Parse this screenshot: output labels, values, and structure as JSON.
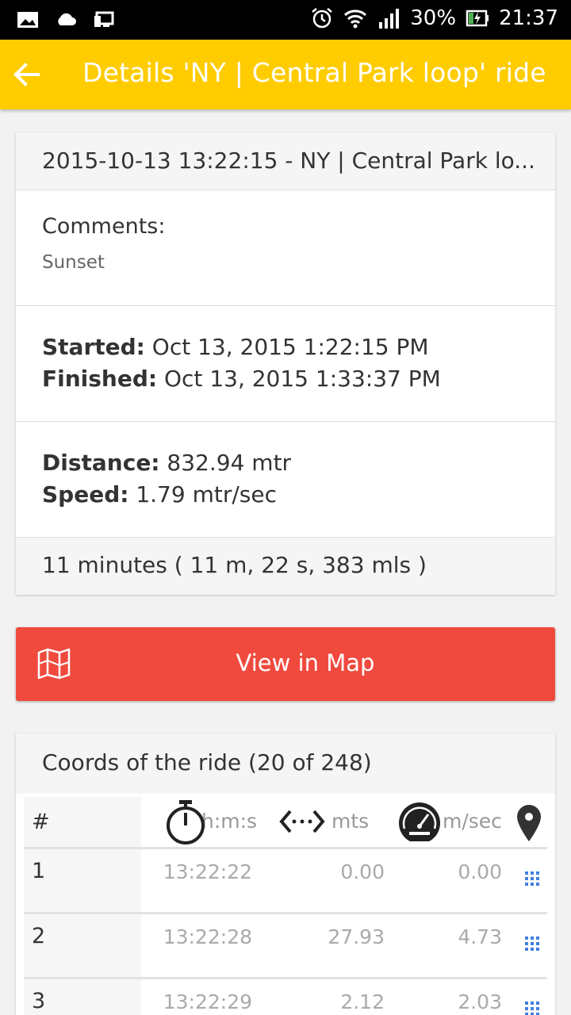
{
  "status_bar": {
    "battery": "30%",
    "time": "21:37",
    "icons": [
      "image-icon",
      "cloud-icon",
      "device-icon",
      "alarm-icon",
      "wifi-icon",
      "signal-icon",
      "battery-charging-icon"
    ]
  },
  "app_bar": {
    "title": "Details 'NY | Central Park loop' ride",
    "back_icon": "arrow-left-icon"
  },
  "ride_card": {
    "header": "2015-10-13 13:22:15 - NY | Central Park lo...",
    "comments_label": "Comments:",
    "comments_value": "Sunset",
    "started_label": "Started:",
    "started_value": "Oct 13, 2015 1:22:15 PM",
    "finished_label": "Finished:",
    "finished_value": "Oct 13, 2015 1:33:37 PM",
    "distance_label": "Distance:",
    "distance_value": "832.94 mtr",
    "speed_label": "Speed:",
    "speed_value": "1.79 mtr/sec",
    "duration": "11 minutes ( 11 m, 22 s, 383 mls )"
  },
  "map_button": {
    "label": "View in Map",
    "icon": "map-icon",
    "color": "#f04a3e"
  },
  "coords_card": {
    "header": "Coords of the ride (20 of 248)",
    "columns": {
      "num": "#",
      "time": "h:m:s",
      "dist": "mts",
      "speed": "m/sec"
    },
    "rows": [
      {
        "num": "1",
        "time": "13:22:22",
        "dist": "0.00",
        "speed": "0.00"
      },
      {
        "num": "2",
        "time": "13:22:28",
        "dist": "27.93",
        "speed": "4.73"
      },
      {
        "num": "3",
        "time": "13:22:29",
        "dist": "2.12",
        "speed": "2.03"
      }
    ]
  },
  "colors": {
    "accent": "#ffcc00",
    "button": "#f04a3e"
  }
}
